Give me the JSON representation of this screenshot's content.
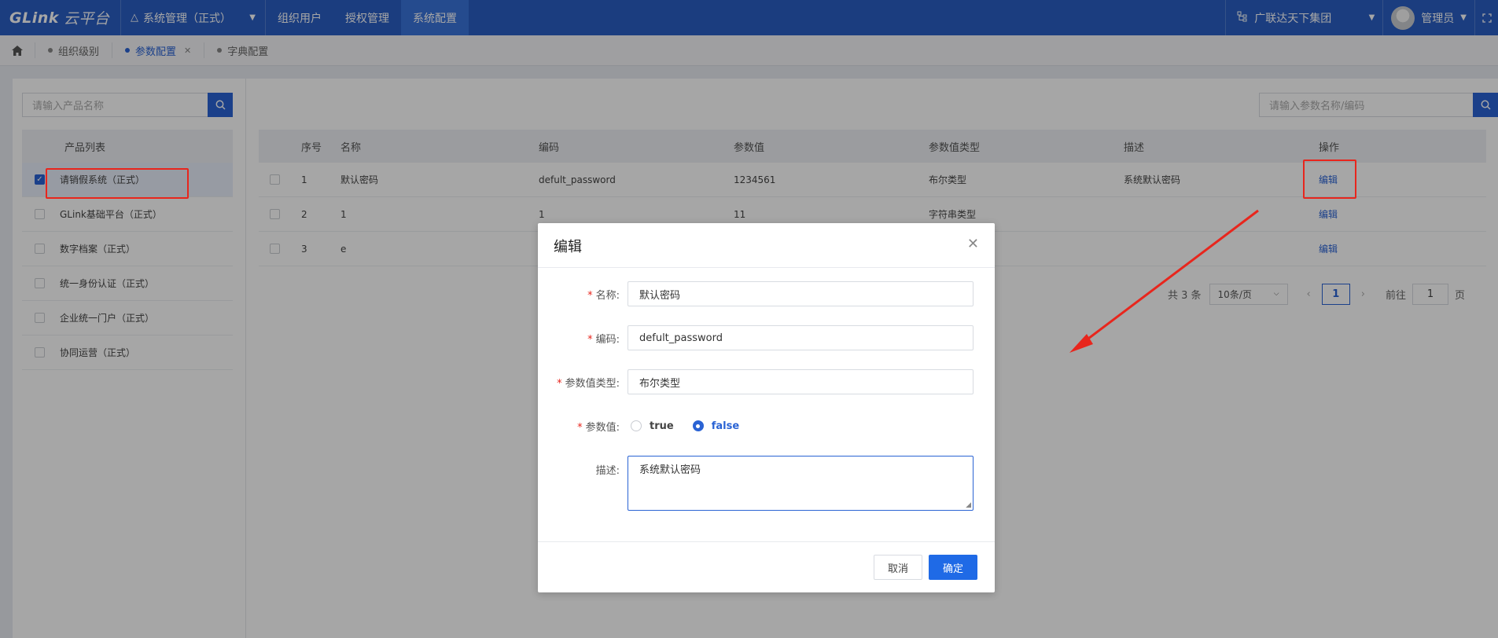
{
  "header": {
    "logo_text": "GLink",
    "logo_cn": "云平台",
    "system_label": "系统管理（正式）",
    "nav": [
      "组织用户",
      "授权管理",
      "系统配置"
    ],
    "active_nav": "系统配置",
    "org_name": "广联达天下集团",
    "user_name": "管理员"
  },
  "tabs": [
    {
      "label": "组织级别",
      "active": false
    },
    {
      "label": "参数配置",
      "active": true
    },
    {
      "label": "字典配置",
      "active": false
    }
  ],
  "left": {
    "search_placeholder": "请输入产品名称",
    "list_header": "产品列表",
    "products": [
      "请销假系统（正式）",
      "GLink基础平台（正式）",
      "数字档案（正式）",
      "统一身份认证（正式）",
      "企业统一门户（正式）",
      "协同运营（正式）"
    ],
    "selected_index": 0
  },
  "grid": {
    "search_placeholder": "请输入参数名称/编码",
    "columns": [
      "序号",
      "名称",
      "编码",
      "参数值",
      "参数值类型",
      "描述",
      "操作"
    ],
    "rows": [
      {
        "no": "1",
        "name": "默认密码",
        "code": "defult_password",
        "value": "1234561",
        "type": "布尔类型",
        "desc": "系统默认密码",
        "action": "编辑"
      },
      {
        "no": "2",
        "name": "1",
        "code": "1",
        "value": "11",
        "type": "字符串类型",
        "desc": "",
        "action": "编辑"
      },
      {
        "no": "3",
        "name": "e",
        "code": "",
        "value": "",
        "type": "",
        "desc": "",
        "action": "编辑"
      }
    ]
  },
  "pager": {
    "total": "共 3 条",
    "page_size": "10条/页",
    "current_page": "1",
    "goto_label": "前往",
    "goto_value": "1",
    "page_suffix": "页"
  },
  "modal": {
    "title": "编辑",
    "name_label": "名称:",
    "name_value": "默认密码",
    "code_label": "编码:",
    "code_value": "defult_password",
    "type_label": "参数值类型:",
    "type_value": "布尔类型",
    "value_label": "参数值:",
    "radio_true": "true",
    "radio_false": "false",
    "radio_selected": "false",
    "desc_label": "描述:",
    "desc_value": "系统默认密码",
    "cancel_label": "取消",
    "ok_label": "确定"
  },
  "colors": {
    "header_bg": "#2a5ec4",
    "accent": "#2a63d4",
    "annotation": "#e8261d"
  }
}
